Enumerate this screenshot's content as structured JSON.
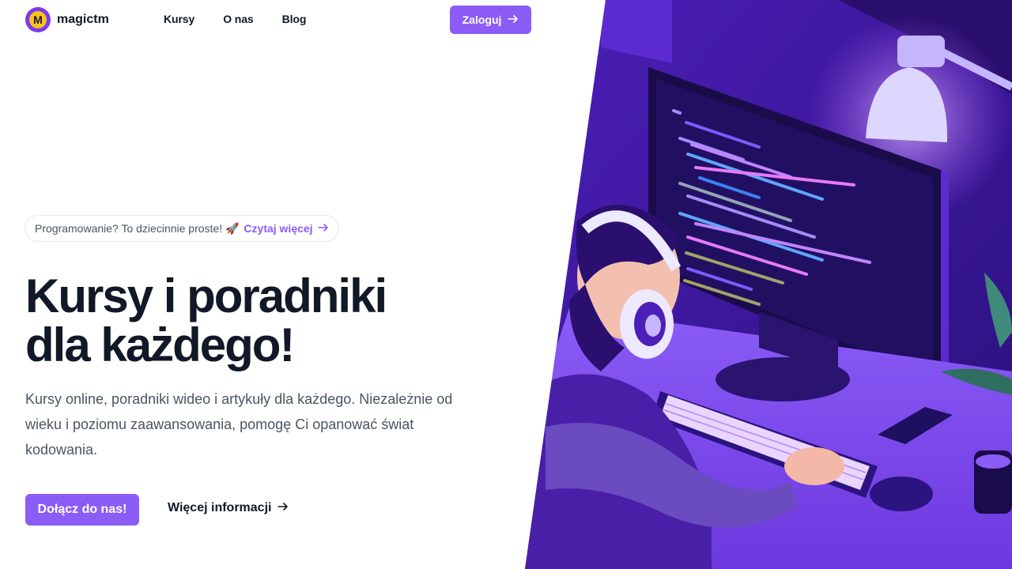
{
  "header": {
    "brand": "magictm",
    "logo_letter": "M",
    "nav": [
      {
        "label": "Kursy"
      },
      {
        "label": "O nas"
      },
      {
        "label": "Blog"
      }
    ],
    "login_label": "Zaloguj",
    "login_icon": "arrow-right-icon"
  },
  "announcement": {
    "text": "Programowanie? To dziecinnie proste! 🚀",
    "link_label": "Czytaj więcej",
    "link_icon": "arrow-right-icon"
  },
  "hero": {
    "title_line1": "Kursy i poradniki",
    "title_line2": "dla każdego!",
    "description": "Kursy online, poradniki wideo i artykuły dla każdego. Niezależnie od wieku i poziomu zaawansowania, pomogę Ci opanować świat kodowania.",
    "primary_cta": "Dołącz do nas!",
    "secondary_cta": "Więcej informacji",
    "secondary_icon": "arrow-right-icon"
  },
  "colors": {
    "accent": "#8b5cf6",
    "illustration_bg": "#3b1a9e",
    "brand_yellow": "#f5c518"
  },
  "illustration": {
    "subject": "developer-at-computer",
    "icon": "coding-illustration"
  }
}
